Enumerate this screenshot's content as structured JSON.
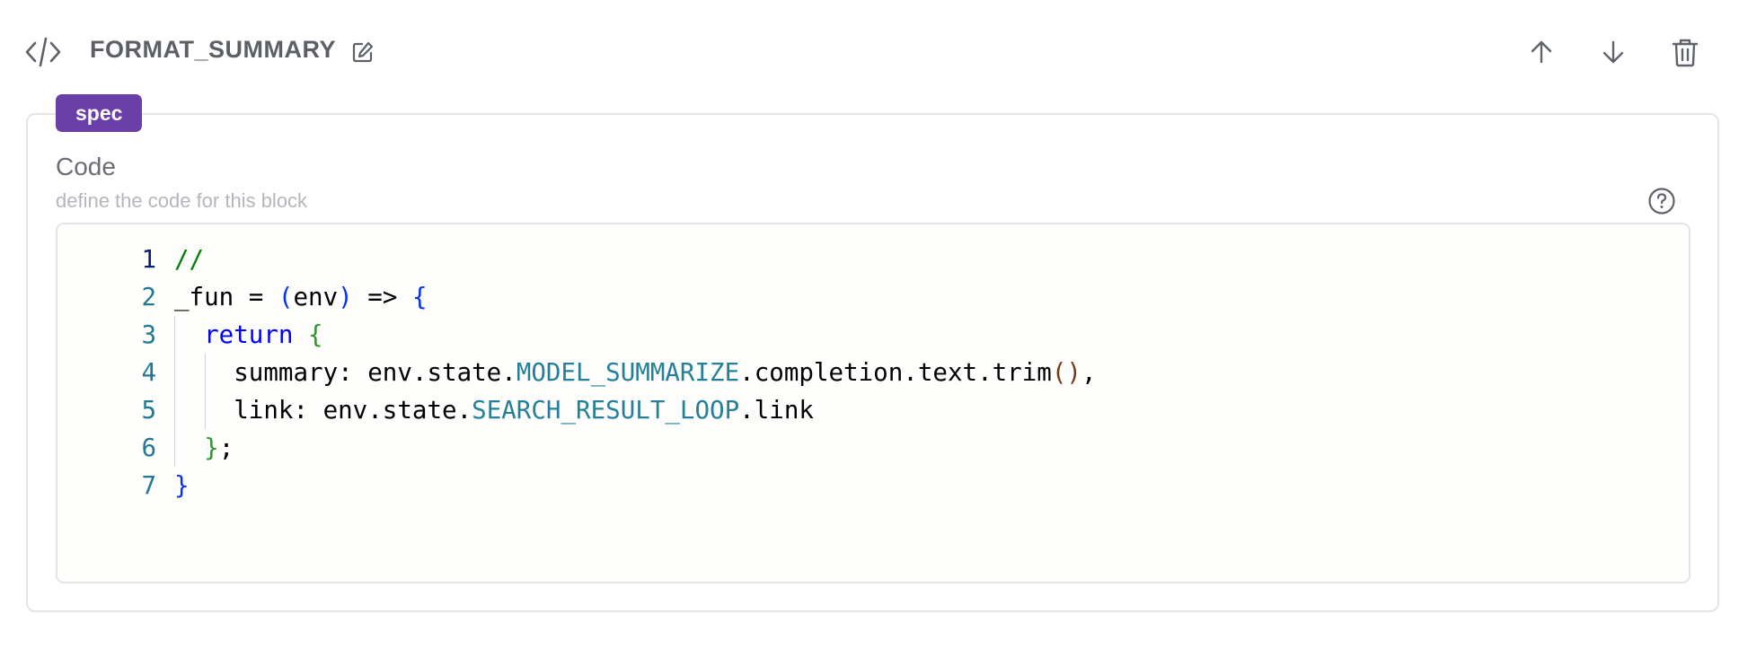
{
  "block": {
    "title": "FORMAT_SUMMARY",
    "tag": "spec"
  },
  "icons": {
    "type": "code-brackets-icon",
    "edit": "edit-icon",
    "move_up": "arrow-up-icon",
    "move_down": "arrow-down-icon",
    "delete": "trash-icon",
    "help": "question-circle-icon"
  },
  "field": {
    "label": "Code",
    "description": "define the code for this block"
  },
  "editor": {
    "lines": [
      {
        "number": "1",
        "tokens": [
          {
            "text": "//",
            "type": "comment"
          }
        ]
      },
      {
        "number": "2",
        "tokens": [
          {
            "text": "_fun = ",
            "type": "id"
          },
          {
            "text": "(",
            "type": "b1"
          },
          {
            "text": "env",
            "type": "id"
          },
          {
            "text": ")",
            "type": "b1"
          },
          {
            "text": " => ",
            "type": "id"
          },
          {
            "text": "{",
            "type": "b1"
          }
        ]
      },
      {
        "number": "3",
        "tokens": [
          {
            "text": "  ",
            "type": "id"
          },
          {
            "text": "return",
            "type": "kw"
          },
          {
            "text": " ",
            "type": "id"
          },
          {
            "text": "{",
            "type": "b2"
          }
        ]
      },
      {
        "number": "4",
        "tokens": [
          {
            "text": "    summary: env.state.",
            "type": "id"
          },
          {
            "text": "MODEL_SUMMARIZE",
            "type": "const"
          },
          {
            "text": ".completion.text.trim",
            "type": "id"
          },
          {
            "text": "()",
            "type": "b3"
          },
          {
            "text": ",",
            "type": "id"
          }
        ]
      },
      {
        "number": "5",
        "tokens": [
          {
            "text": "    link: env.state.",
            "type": "id"
          },
          {
            "text": "SEARCH_RESULT_LOOP",
            "type": "const"
          },
          {
            "text": ".link",
            "type": "id"
          }
        ]
      },
      {
        "number": "6",
        "tokens": [
          {
            "text": "  ",
            "type": "id"
          },
          {
            "text": "}",
            "type": "b2"
          },
          {
            "text": ";",
            "type": "id"
          }
        ]
      },
      {
        "number": "7",
        "tokens": [
          {
            "text": "}",
            "type": "b1"
          }
        ]
      }
    ]
  },
  "colors": {
    "tag_background": "#6a3fa8",
    "comment": "#008000",
    "keyword": "#0000ff",
    "constant": "#267f99",
    "line_number": "#237893"
  }
}
